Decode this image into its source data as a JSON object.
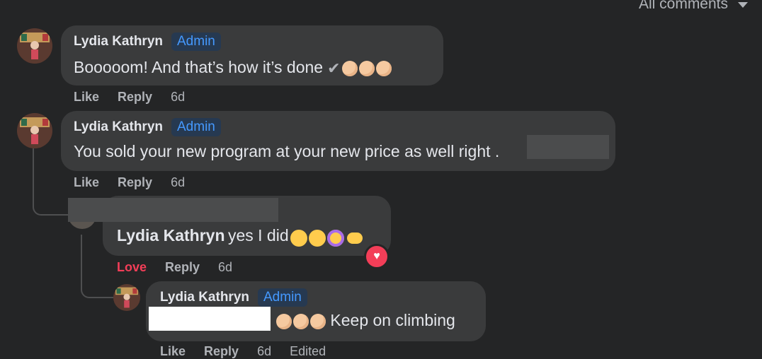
{
  "filter": {
    "label": "All comments"
  },
  "comments": [
    {
      "author": "Lydia Kathryn",
      "badge": "Admin",
      "text": "Booooom! And that’s how it’s done",
      "actions": {
        "like": "Like",
        "reply": "Reply",
        "time": "6d"
      }
    },
    {
      "author": "Lydia Kathryn",
      "badge": "Admin",
      "text": "You sold your new program at your new price as well right .",
      "actions": {
        "like": "Like",
        "reply": "Reply",
        "time": "6d"
      }
    },
    {
      "mention": "Lydia Kathryn",
      "text": "yes I did",
      "reaction": "love",
      "actions": {
        "like": "Love",
        "reply": "Reply",
        "time": "6d"
      }
    },
    {
      "author": "Lydia Kathryn",
      "badge": "Admin",
      "text": "Keep on climbing",
      "actions": {
        "like": "Like",
        "reply": "Reply",
        "time": "6d",
        "edited": "Edited"
      }
    }
  ]
}
